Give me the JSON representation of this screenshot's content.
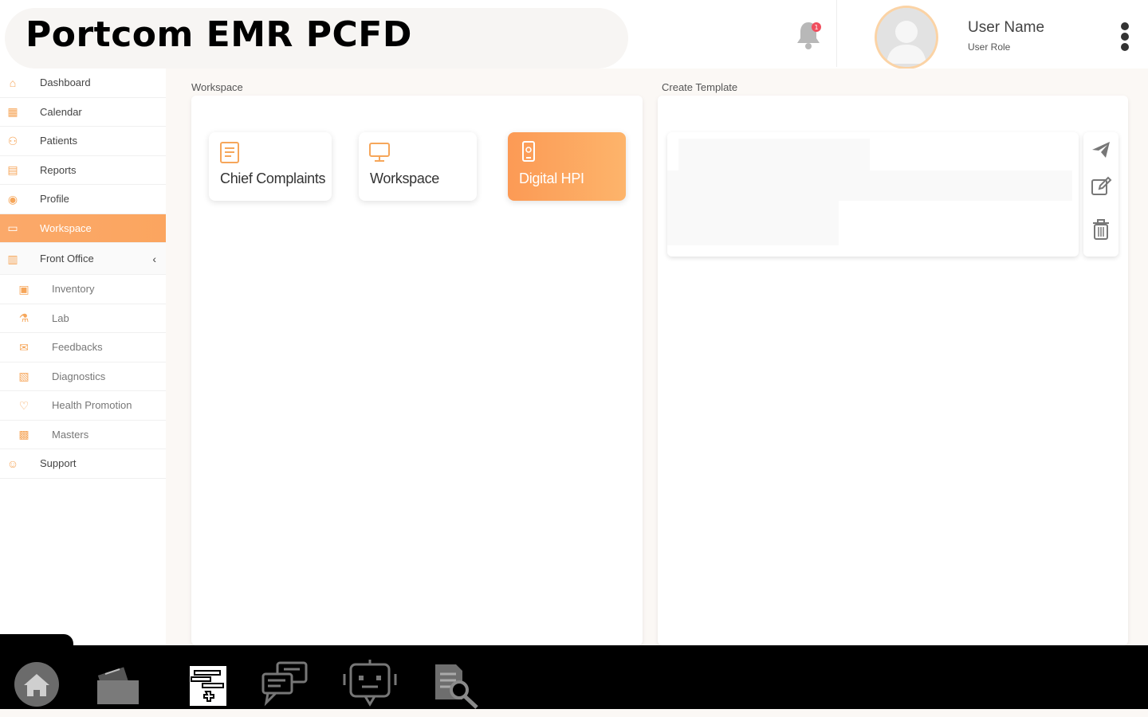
{
  "header": {
    "title": "Portcom EMR PCFD",
    "notification_count": "1",
    "user_name": "User Name",
    "user_role": "User Role"
  },
  "sidebar": {
    "items": [
      {
        "label": "Dashboard",
        "icon": "home-icon"
      },
      {
        "label": "Calendar",
        "icon": "calendar-icon"
      },
      {
        "label": "Patients",
        "icon": "patients-icon"
      },
      {
        "label": "Reports",
        "icon": "reports-icon"
      },
      {
        "label": "Profile",
        "icon": "profile-icon"
      },
      {
        "label": "Workspace",
        "icon": "monitor-icon",
        "active": true
      },
      {
        "label": "Front Office",
        "icon": "front-office-icon",
        "expanded": true
      },
      {
        "label": "Inventory",
        "icon": "inventory-icon"
      },
      {
        "label": "Lab",
        "icon": "lab-icon"
      },
      {
        "label": "Feedbacks",
        "icon": "feedback-icon"
      },
      {
        "label": "Diagnostics",
        "icon": "diagnostics-icon"
      },
      {
        "label": "Health Promotion",
        "icon": "health-promotion-icon"
      },
      {
        "label": "Masters",
        "icon": "masters-icon"
      },
      {
        "label": "Support",
        "icon": "support-icon"
      }
    ]
  },
  "workspace": {
    "section_title": "Workspace",
    "cards": [
      {
        "label": "Chief Complaints",
        "icon": "document-list-icon"
      },
      {
        "label": "Workspace",
        "icon": "monitor-icon"
      },
      {
        "label": "Digital HPI",
        "icon": "mobile-device-icon",
        "highlighted": true
      }
    ]
  },
  "template": {
    "section_title": "Create Template",
    "tools": [
      "send-icon",
      "edit-icon",
      "trash-icon"
    ]
  },
  "dock": {
    "items": [
      "home-icon",
      "folder-icon",
      "medical-record-icon",
      "chat-icon",
      "robot-icon",
      "document-search-icon"
    ]
  },
  "colors": {
    "accent": "#fba55f",
    "accent_light": "#fdb46b",
    "badge": "#f04e5e",
    "dock_bg": "#000000"
  }
}
